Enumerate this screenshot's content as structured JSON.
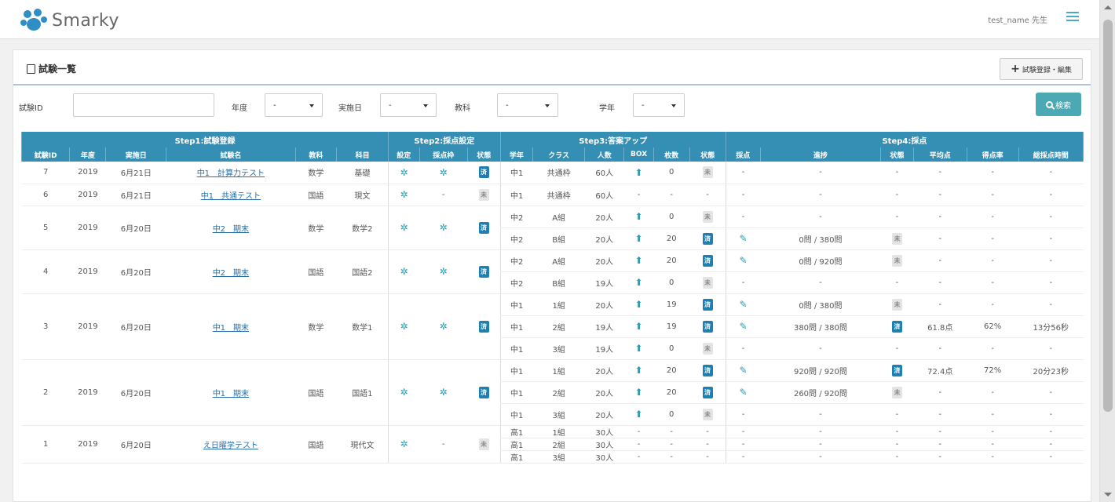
{
  "header": {
    "logo_text": "Smarky",
    "user": "test_name 先生",
    "menu_icon": "hamburger-icon"
  },
  "page": {
    "title": "試験一覧",
    "register_button": "試験登録・編集"
  },
  "filters": {
    "exam_id_label": "試験ID",
    "exam_id_value": "",
    "year_label": "年度",
    "year_value": "-",
    "date_label": "実施日",
    "date_value": "-",
    "subject_label": "教科",
    "subject_value": "-",
    "grade_label": "学年",
    "grade_value": "-",
    "search_button": "検索"
  },
  "table": {
    "groups": [
      "Step1:試験登録",
      "Step2:採点設定",
      "Step3:答案アップ",
      "Step4:採点"
    ],
    "columns": [
      "試験ID",
      "年度",
      "実施日",
      "試験名",
      "教科",
      "科目",
      "設定",
      "採点枠",
      "状態",
      "学年",
      "クラス",
      "人数",
      "BOX",
      "枚数",
      "状態",
      "採点",
      "進捗",
      "状態",
      "平均点",
      "得点率",
      "総採点時間"
    ],
    "exams": [
      {
        "id": "7",
        "year": "2019",
        "date": "6月21日",
        "name": "中1　計算力テスト",
        "subject": "数学",
        "course": "基礎",
        "st2": "done",
        "setting": true,
        "frame": true,
        "rows": [
          {
            "grade": "中1",
            "class": "共通枠",
            "num": "60人",
            "box": true,
            "sheets": "0",
            "up": "u",
            "pen": false,
            "prog": "-",
            "st4": null,
            "avg": "-",
            "rate": "-",
            "time": "-"
          }
        ]
      },
      {
        "id": "6",
        "year": "2019",
        "date": "6月21日",
        "name": "中1　共通テスト",
        "subject": "国語",
        "course": "現文",
        "st2": "todo",
        "setting": true,
        "frame": false,
        "rows": [
          {
            "grade": "中1",
            "class": "共通枠",
            "num": "60人",
            "box": false,
            "sheets": "-",
            "up": null,
            "pen": false,
            "prog": "-",
            "st4": null,
            "avg": "-",
            "rate": "-",
            "time": "-"
          }
        ]
      },
      {
        "id": "5",
        "year": "2019",
        "date": "6月20日",
        "name": "中2　期末",
        "subject": "数学",
        "course": "数学2",
        "st2": "done",
        "setting": true,
        "frame": true,
        "rows": [
          {
            "grade": "中2",
            "class": "A組",
            "num": "20人",
            "box": true,
            "sheets": "0",
            "up": "u",
            "pen": false,
            "prog": "-",
            "st4": null,
            "avg": "-",
            "rate": "-",
            "time": "-"
          },
          {
            "grade": "中2",
            "class": "B組",
            "num": "20人",
            "box": true,
            "sheets": "20",
            "up": "f",
            "pen": true,
            "prog": "0問 / 380問",
            "st4": "u",
            "avg": "-",
            "rate": "-",
            "time": "-"
          }
        ]
      },
      {
        "id": "4",
        "year": "2019",
        "date": "6月20日",
        "name": "中2　期末",
        "subject": "国語",
        "course": "国語2",
        "st2": "done",
        "setting": true,
        "frame": true,
        "rows": [
          {
            "grade": "中2",
            "class": "A組",
            "num": "20人",
            "box": true,
            "sheets": "20",
            "up": "f",
            "pen": true,
            "prog": "0問 / 920問",
            "st4": "u",
            "avg": "-",
            "rate": "-",
            "time": "-"
          },
          {
            "grade": "中2",
            "class": "B組",
            "num": "19人",
            "box": true,
            "sheets": "0",
            "up": "u",
            "pen": false,
            "prog": "-",
            "st4": null,
            "avg": "-",
            "rate": "-",
            "time": "-"
          }
        ]
      },
      {
        "id": "3",
        "year": "2019",
        "date": "6月20日",
        "name": "中1　期末",
        "subject": "数学",
        "course": "数学1",
        "st2": "done",
        "setting": true,
        "frame": true,
        "rows": [
          {
            "grade": "中1",
            "class": "1組",
            "num": "20人",
            "box": true,
            "sheets": "19",
            "up": "f",
            "pen": true,
            "prog": "0問 / 380問",
            "st4": "u",
            "avg": "-",
            "rate": "-",
            "time": "-"
          },
          {
            "grade": "中1",
            "class": "2組",
            "num": "19人",
            "box": true,
            "sheets": "19",
            "up": "f",
            "pen": true,
            "prog": "380問 / 380問",
            "st4": "f",
            "avg": "61.8点",
            "rate": "62%",
            "time": "13分56秒"
          },
          {
            "grade": "中1",
            "class": "3組",
            "num": "19人",
            "box": true,
            "sheets": "0",
            "up": "u",
            "pen": false,
            "prog": "-",
            "st4": null,
            "avg": "-",
            "rate": "-",
            "time": "-"
          }
        ]
      },
      {
        "id": "2",
        "year": "2019",
        "date": "6月20日",
        "name": "中1　期末",
        "subject": "国語",
        "course": "国語1",
        "st2": "done",
        "setting": true,
        "frame": true,
        "rows": [
          {
            "grade": "中1",
            "class": "1組",
            "num": "20人",
            "box": true,
            "sheets": "20",
            "up": "f",
            "pen": true,
            "prog": "920問 / 920問",
            "st4": "f",
            "avg": "72.4点",
            "rate": "72%",
            "time": "20分23秒"
          },
          {
            "grade": "中1",
            "class": "2組",
            "num": "20人",
            "box": true,
            "sheets": "20",
            "up": "f",
            "pen": true,
            "prog": "260問 / 920問",
            "st4": "u",
            "avg": "-",
            "rate": "-",
            "time": "-"
          },
          {
            "grade": "中1",
            "class": "3組",
            "num": "20人",
            "box": true,
            "sheets": "0",
            "up": "u",
            "pen": false,
            "prog": "-",
            "st4": null,
            "avg": "-",
            "rate": "-",
            "time": "-"
          }
        ]
      },
      {
        "id": "1",
        "year": "2019",
        "date": "6月20日",
        "name": "え日曜学テスト",
        "subject": "国語",
        "course": "現代文",
        "st2": "todo",
        "setting": true,
        "frame": false,
        "short": true,
        "rows": [
          {
            "grade": "高1",
            "class": "1組",
            "num": "30人",
            "box": false,
            "sheets": "-",
            "up": null,
            "pen": false,
            "prog": "-",
            "st4": null,
            "avg": "-",
            "rate": "-",
            "time": "-"
          },
          {
            "grade": "高1",
            "class": "2組",
            "num": "30人",
            "box": false,
            "sheets": "-",
            "up": null,
            "pen": false,
            "prog": "-",
            "st4": null,
            "avg": "-",
            "rate": "-",
            "time": "-"
          },
          {
            "grade": "高1",
            "class": "3組",
            "num": "30人",
            "box": false,
            "sheets": "-",
            "up": null,
            "pen": false,
            "prog": "-",
            "st4": null,
            "avg": "-",
            "rate": "-",
            "time": "-"
          }
        ]
      }
    ],
    "badge_done": "済",
    "badge_todo": "未",
    "colors": {
      "header": "#358fb5",
      "accent": "#2b9bb0",
      "badge": "#1f7fb0"
    }
  }
}
